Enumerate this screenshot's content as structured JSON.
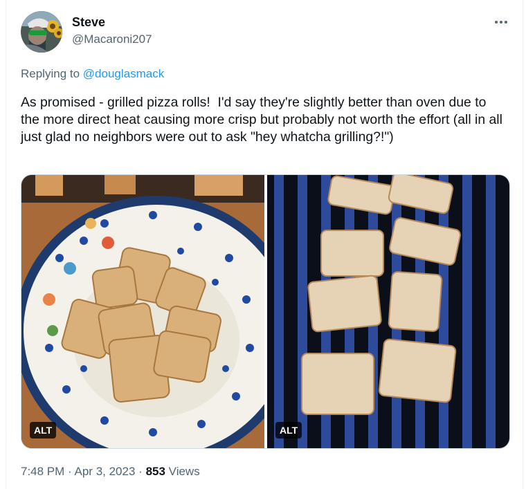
{
  "tweet": {
    "author_name": "Steve",
    "author_handle": "@Macaroni207",
    "more_icon": "more-horizontal-icon",
    "replying_to_prefix": "Replying to",
    "replying_to_handle": "@douglasmack",
    "text": "As promised - grilled pizza rolls!  I'd say they're slightly better than oven due to the more direct heat causing more crisp but probably not worth the effort (all in all just glad no neighbors were out to ask \"hey whatcha grilling?!\")",
    "media": [
      {
        "alt_badge": "ALT"
      },
      {
        "alt_badge": "ALT"
      }
    ],
    "time": "7:48 PM",
    "date": "Apr 3, 2023",
    "separator": "·",
    "views_count": "853",
    "views_label": "Views"
  },
  "colors": {
    "text_primary": "#0f1419",
    "text_secondary": "#536471",
    "link": "#1d9bf0",
    "border": "#cfd9de"
  }
}
